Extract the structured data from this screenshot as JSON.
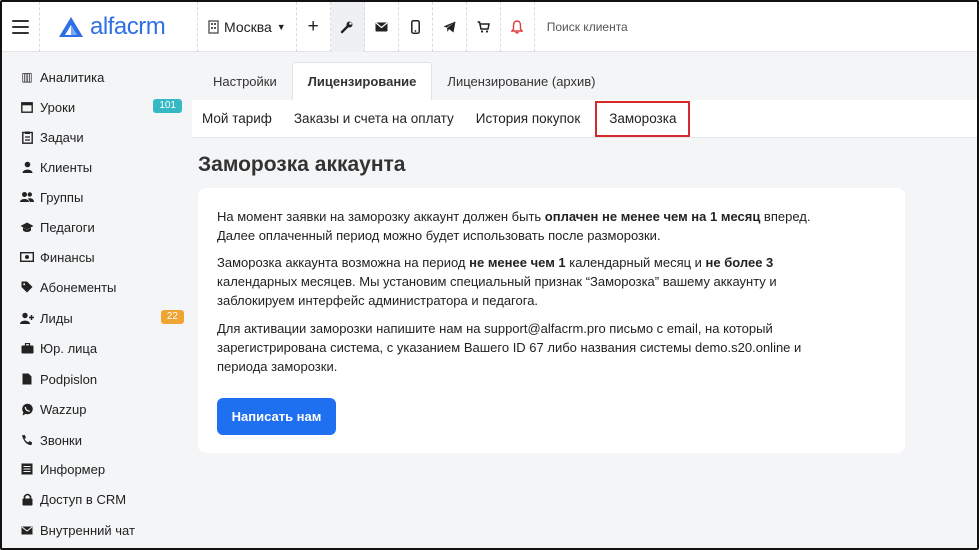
{
  "topbar": {
    "logo_text": "alfacrm",
    "city": "Москва",
    "search_placeholder": "Поиск клиента",
    "accent": "#2f6fe4",
    "icons": [
      "menu-icon",
      "building-icon",
      "chevron-down-icon",
      "plus-icon",
      "wrench-icon",
      "mail-icon",
      "phone-icon",
      "telegram-icon",
      "cart-icon",
      "bell-icon"
    ]
  },
  "sidebar": {
    "items": [
      {
        "label": "Аналитика",
        "icon": "chart-icon"
      },
      {
        "label": "Уроки",
        "icon": "calendar-icon",
        "badge": "101",
        "badge_color": "#36b8c5"
      },
      {
        "label": "Задачи",
        "icon": "clipboard-icon"
      },
      {
        "label": "Клиенты",
        "icon": "user-icon"
      },
      {
        "label": "Группы",
        "icon": "users-icon"
      },
      {
        "label": "Педагоги",
        "icon": "graduation-cap-icon"
      },
      {
        "label": "Финансы",
        "icon": "money-icon"
      },
      {
        "label": "Абонементы",
        "icon": "tag-icon"
      },
      {
        "label": "Лиды",
        "icon": "user-plus-icon",
        "badge": "22",
        "badge_color": "#f0a431"
      },
      {
        "label": "Юр. лица",
        "icon": "briefcase-icon"
      },
      {
        "label": "Podpislon",
        "icon": "document-icon"
      },
      {
        "label": "Wazzup",
        "icon": "whatsapp-icon"
      },
      {
        "label": "Звонки",
        "icon": "phone-call-icon"
      },
      {
        "label": "Информер",
        "icon": "list-icon"
      },
      {
        "label": "Доступ в CRM",
        "icon": "lock-icon"
      },
      {
        "label": "Внутренний чат",
        "icon": "envelope-icon"
      }
    ]
  },
  "tabs": {
    "primary": [
      {
        "label": "Настройки",
        "active": false
      },
      {
        "label": "Лицензирование",
        "active": true
      },
      {
        "label": "Лицензирование (архив)",
        "active": false
      }
    ],
    "secondary": [
      {
        "label": "Мой тариф"
      },
      {
        "label": "Заказы и счета на оплату"
      },
      {
        "label": "История покупок"
      },
      {
        "label": "Заморозка",
        "highlighted": true
      }
    ]
  },
  "main": {
    "title": "Заморозка аккаунта",
    "p1": {
      "a": "На момент заявки на заморозку аккаунт должен быть ",
      "b": "оплачен не менее чем на 1 месяц",
      "c": " вперед.",
      "d": "Далее оплаченный период можно будет использовать после разморозки."
    },
    "p2": {
      "a": "Заморозка аккаунта возможна на период ",
      "b": "не менее чем 1",
      "c": " календарный месяц и ",
      "d": "не более 3",
      "e": "календарных месяцев. Мы установим специальный признак “Заморозка” вашему аккаунту и",
      "f": "заблокируем интерфейс администратора и педагога."
    },
    "p3": {
      "a": "Для активации заморозки напишите нам на support@alfacrm.pro письмо с email, на который",
      "b": "зарегистрирована система, с указанием Вашего ID 67 либо названия системы demo.s20.online и",
      "c": "периода заморозки."
    },
    "button": "Написать нам",
    "button_color": "#1f6ff1"
  }
}
